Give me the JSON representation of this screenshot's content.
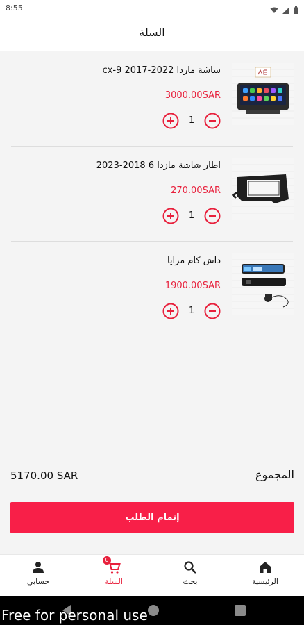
{
  "status_bar": {
    "time": "8:55"
  },
  "header": {
    "title": "السلة"
  },
  "cart": {
    "items": [
      {
        "name": "شاشة مازدا 2022-2017 cx-9",
        "price": "3000.00SAR",
        "quantity": "1"
      },
      {
        "name": "اطار شاشة مازدا 6 2018-2023",
        "price": "270.00SAR",
        "quantity": "1"
      },
      {
        "name": "داش كام مرايا",
        "price": "1900.00SAR",
        "quantity": "1"
      }
    ]
  },
  "summary": {
    "label": "المجموع",
    "total": "5170.00 SAR"
  },
  "checkout": {
    "label": "إتمام الطلب"
  },
  "bottom_nav": {
    "items": [
      {
        "label": "الرئيسية",
        "icon": "home-icon"
      },
      {
        "label": "بحث",
        "icon": "search-icon"
      },
      {
        "label": "السلة",
        "icon": "cart-icon",
        "badge": "0",
        "active": true
      },
      {
        "label": "حسابي",
        "icon": "person-icon"
      }
    ]
  },
  "watermark": "Free for personal use",
  "colors": {
    "accent": "#e8203c",
    "checkout": "#f81f48"
  }
}
